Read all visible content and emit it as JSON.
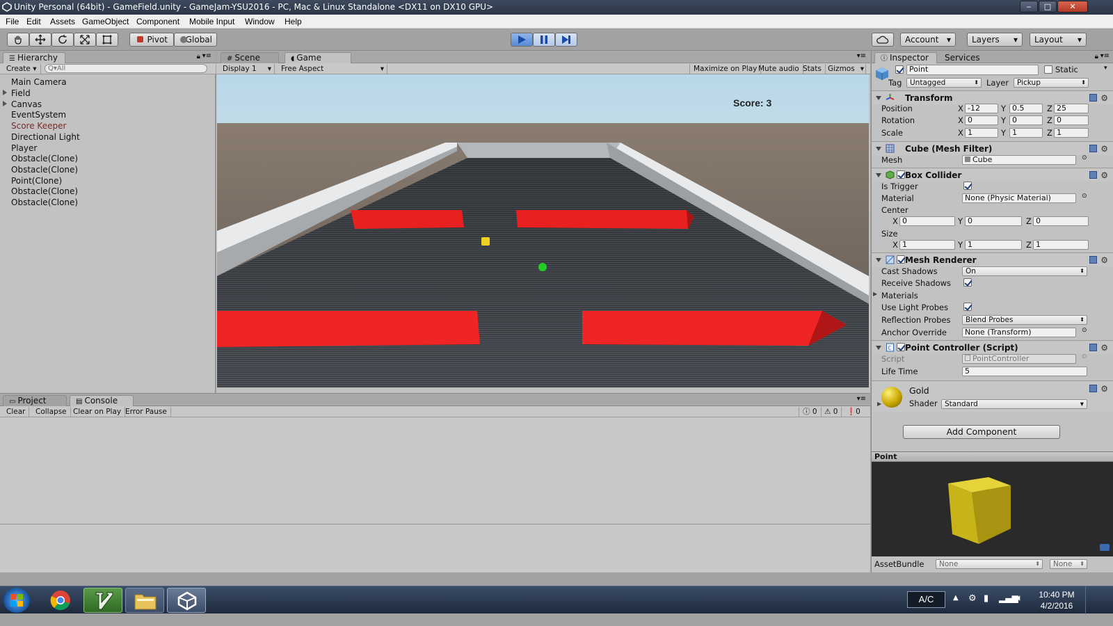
{
  "window": {
    "title": "Unity Personal (64bit) - GameField.unity - GameJam-YSU2016 - PC, Mac & Linux Standalone <DX11 on DX10 GPU>",
    "controls": {
      "minimize": "‒",
      "maximize": "□",
      "close": "✕"
    }
  },
  "menu": [
    "File",
    "Edit",
    "Assets",
    "GameObject",
    "Component",
    "Mobile Input",
    "Window",
    "Help"
  ],
  "toolbar": {
    "pivot": "Pivot",
    "global": "Global",
    "account": "Account",
    "layers": "Layers",
    "layout": "Layout",
    "accent": "#5a8ad6"
  },
  "hierarchy": {
    "tab": "Hierarchy",
    "create": "Create",
    "search_placeholder": "Q▾All",
    "items": [
      {
        "label": "Main Camera",
        "color": "#111111"
      },
      {
        "label": "Field",
        "color": "#111111"
      },
      {
        "label": "Canvas",
        "color": "#111111"
      },
      {
        "label": "EventSystem",
        "color": "#111111"
      },
      {
        "label": "Score Keeper",
        "color": "#7a2a2a"
      },
      {
        "label": "Directional Light",
        "color": "#111111"
      },
      {
        "label": "Player",
        "color": "#111111"
      },
      {
        "label": "Obstacle(Clone)",
        "color": "#111111"
      },
      {
        "label": "Obstacle(Clone)",
        "color": "#111111"
      },
      {
        "label": "Point(Clone)",
        "color": "#111111"
      },
      {
        "label": "Obstacle(Clone)",
        "color": "#111111"
      },
      {
        "label": "Obstacle(Clone)",
        "color": "#111111"
      }
    ]
  },
  "game": {
    "tab_scene": "Scene",
    "tab_game": "Game",
    "display": "Display 1",
    "aspect": "Free Aspect",
    "maximize": "Maximize on Play",
    "mute": "Mute audio",
    "stats": "Stats",
    "gizmos": "Gizmos",
    "score": "Score: 3",
    "colors": {
      "obstacle": "#e82020",
      "point": "#f0d020",
      "player": "#22cc22"
    }
  },
  "console": {
    "tab_project": "Project",
    "tab_console": "Console",
    "clear": "Clear",
    "collapse": "Collapse",
    "clear_on_play": "Clear on Play",
    "error_pause": "Error Pause",
    "info_count": "0",
    "warn_count": "0",
    "error_count": "0"
  },
  "inspector": {
    "tab": "Inspector",
    "services": "Services",
    "object_name": "Point",
    "static": "Static",
    "tag_label": "Tag",
    "tag": "Untagged",
    "layer_label": "Layer",
    "layer": "Pickup",
    "transform": {
      "title": "Transform",
      "position_label": "Position",
      "rotation_label": "Rotation",
      "scale_label": "Scale",
      "position": {
        "x": "-12",
        "y": "0.5",
        "z": "25"
      },
      "rotation": {
        "x": "0",
        "y": "0",
        "z": "0"
      },
      "scale": {
        "x": "1",
        "y": "1",
        "z": "1"
      }
    },
    "mesh_filter": {
      "title": "Cube (Mesh Filter)",
      "mesh_label": "Mesh",
      "mesh": "Cube"
    },
    "box_collider": {
      "title": "Box Collider",
      "is_trigger_label": "Is Trigger",
      "material_label": "Material",
      "material": "None (Physic Material)",
      "center_label": "Center",
      "center": {
        "x": "0",
        "y": "0",
        "z": "0"
      },
      "size_label": "Size",
      "size": {
        "x": "1",
        "y": "1",
        "z": "1"
      }
    },
    "mesh_renderer": {
      "title": "Mesh Renderer",
      "cast_shadows_label": "Cast Shadows",
      "cast_shadows": "On",
      "receive_shadows_label": "Receive Shadows",
      "materials_label": "Materials",
      "use_light_probes_label": "Use Light Probes",
      "reflection_probes_label": "Reflection Probes",
      "reflection_probes": "Blend Probes",
      "anchor_override_label": "Anchor Override",
      "anchor_override": "None (Transform)"
    },
    "point_controller": {
      "title": "Point Controller (Script)",
      "script_label": "Script",
      "script": "PointController",
      "life_time_label": "Life Time",
      "life_time": "5"
    },
    "material": {
      "name": "Gold",
      "shader_label": "Shader",
      "shader": "Standard"
    },
    "add_component": "Add Component",
    "preview": {
      "title": "Point",
      "asset_bundle": "AssetBundle",
      "bundle_value": "None",
      "variant_value": "None",
      "cube_color": "#c8b418"
    },
    "axes": {
      "x": "X",
      "y": "Y",
      "z": "Z"
    }
  },
  "taskbar": {
    "lang": "A/C",
    "time": "10:40 PM",
    "date": "4/2/2016"
  }
}
